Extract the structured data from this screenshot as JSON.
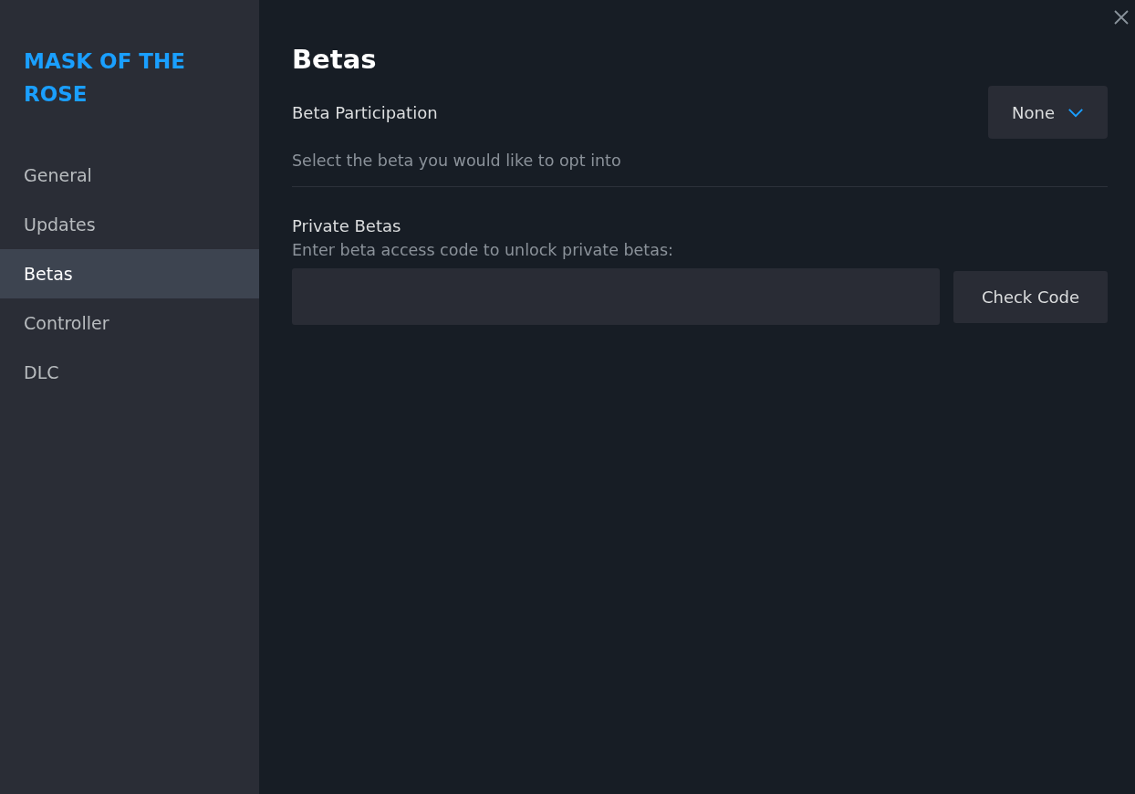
{
  "sidebar": {
    "title": "MASK OF THE ROSE",
    "items": [
      {
        "label": "General",
        "selected": false
      },
      {
        "label": "Updates",
        "selected": false
      },
      {
        "label": "Betas",
        "selected": true
      },
      {
        "label": "Controller",
        "selected": false
      },
      {
        "label": "DLC",
        "selected": false
      }
    ]
  },
  "page": {
    "title": "Betas",
    "participation": {
      "label": "Beta Participation",
      "dropdown_value": "None",
      "description": "Select the beta you would like to opt into"
    },
    "private": {
      "label": "Private Betas",
      "description": "Enter beta access code to unlock private betas:",
      "button": "Check Code"
    }
  }
}
